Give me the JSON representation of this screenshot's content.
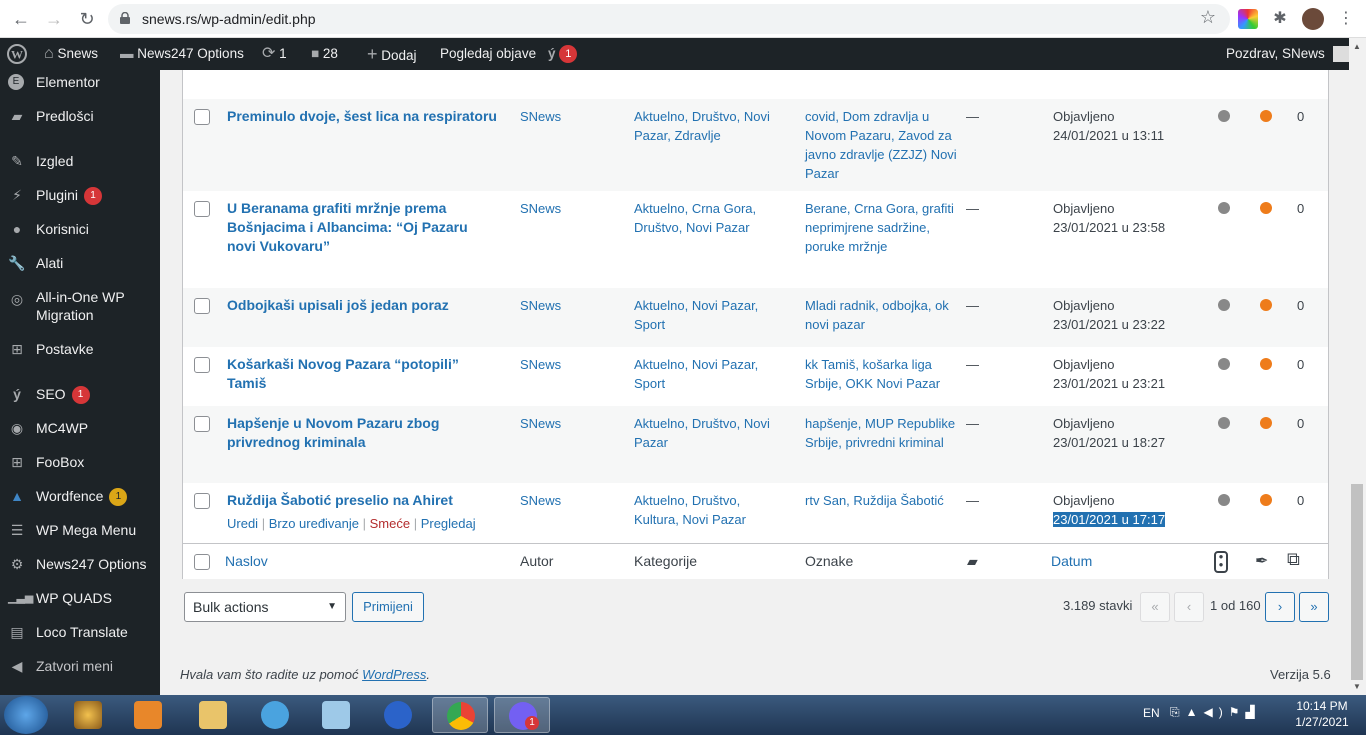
{
  "browser": {
    "url": "snews.rs/wp-admin/edit.php"
  },
  "adminbar": {
    "site": "Snews",
    "options": "News247 Options",
    "updates": "1",
    "comments": "28",
    "add": "Dodaj",
    "view": "Pogledaj objave",
    "seo_count": "1",
    "greeting": "Pozdrav, SNews"
  },
  "sidebar": {
    "items": [
      {
        "label": "Elementor",
        "icon": "elementor-icon"
      },
      {
        "label": "Predlošci",
        "icon": "folder-icon"
      },
      {
        "label": "Izgled",
        "icon": "brush-icon"
      },
      {
        "label": "Plugini",
        "icon": "plugin-icon",
        "badge": "1"
      },
      {
        "label": "Korisnici",
        "icon": "user-icon"
      },
      {
        "label": "Alati",
        "icon": "wrench-icon"
      },
      {
        "label": "All-in-One WP",
        "label2": "Migration",
        "icon": "migration-icon"
      },
      {
        "label": "Postavke",
        "icon": "settings-icon"
      },
      {
        "label": "SEO",
        "icon": "yoast-icon",
        "badge": "1"
      },
      {
        "label": "MC4WP",
        "icon": "mc4wp-icon"
      },
      {
        "label": "FooBox",
        "icon": "foobox-icon"
      },
      {
        "label": "Wordfence",
        "icon": "wordfence-icon",
        "badge": "1"
      },
      {
        "label": "WP Mega Menu",
        "icon": "menu-icon"
      },
      {
        "label": "News247 Options",
        "icon": "gear-icon"
      },
      {
        "label": "WP QUADS",
        "icon": "signal-icon"
      },
      {
        "label": "Loco Translate",
        "icon": "translate-icon"
      },
      {
        "label": "Zatvori meni",
        "icon": "collapse-icon"
      }
    ]
  },
  "posts": [
    {
      "title": "Preminulo dvoje, šest lica na respiratoru",
      "author": "SNews",
      "categories": "Aktuelno, Društvo, Novi Pazar, Zdravlje",
      "tags": "covid, Dom zdravlja u Novom Pazaru, Zavod za javno zdravlje (ZZJZ) Novi Pazar",
      "comments": "—",
      "status": "Objavljeno",
      "date": "24/01/2021 u 13:11",
      "count": "0"
    },
    {
      "title": "U Beranama grafiti mržnje prema Bošnjacima i Albancima: “Oj Pazaru novi Vukovaru”",
      "author": "SNews",
      "categories": "Aktuelno, Crna Gora, Društvo, Novi Pazar",
      "tags": "Berane, Crna Gora, grafiti neprimjrene sadržine, poruke mržnje",
      "comments": "—",
      "status": "Objavljeno",
      "date": "23/01/2021 u 23:58",
      "count": "0"
    },
    {
      "title": "Odbojkaši upisali još jedan poraz",
      "author": "SNews",
      "categories": "Aktuelno, Novi Pazar, Sport",
      "tags": "Mladi radnik, odbojka, ok novi pazar",
      "comments": "—",
      "status": "Objavljeno",
      "date": "23/01/2021 u 23:22",
      "count": "0"
    },
    {
      "title": "Košarkaši Novog Pazara “potopili” Tamiš",
      "author": "SNews",
      "categories": "Aktuelno, Novi Pazar, Sport",
      "tags": "kk Tamiš, košarka liga Srbije, OKK Novi Pazar",
      "comments": "—",
      "status": "Objavljeno",
      "date": "23/01/2021 u 23:21",
      "count": "0"
    },
    {
      "title": "Hapšenje u Novom Pazaru zbog privrednog kriminala",
      "author": "SNews",
      "categories": "Aktuelno, Društvo, Novi Pazar",
      "tags": "hapšenje, MUP Republike Srbije, privredni kriminal",
      "comments": "—",
      "status": "Objavljeno",
      "date": "23/01/2021 u 18:27",
      "count": "0"
    },
    {
      "title": "Ruždija Šabotić preselio na Ahiret",
      "author": "SNews",
      "categories": "Aktuelno, Društvo, Kultura, Novi Pazar",
      "tags": "rtv San, Ruždija Šabotić",
      "comments": "—",
      "status": "Objavljeno",
      "date": "23/01/2021 u 17:17",
      "count": "0"
    }
  ],
  "row_actions": {
    "edit": "Uredi",
    "quick": "Brzo uređivanje",
    "trash": "Smeće",
    "view": "Pregledaj"
  },
  "columns": {
    "title": "Naslov",
    "author": "Autor",
    "categories": "Kategorije",
    "tags": "Oznake",
    "date": "Datum"
  },
  "bulk": {
    "selected": "Bulk actions",
    "apply": "Primijeni"
  },
  "pagination": {
    "items": "3.189 stavki",
    "first": "«",
    "prev": "‹",
    "current": "1 od 160",
    "next": "›",
    "last": "»"
  },
  "footer": {
    "thanks_prefix": "Hvala vam što radite uz pomoć ",
    "wp_link": "WordPress",
    "thanks_suffix": ".",
    "version": "Verzija 5.6"
  },
  "taskbar": {
    "lang": "EN",
    "time": "10:14 PM",
    "date": "1/27/2021",
    "viber_badge": "1"
  },
  "colors": {
    "accent": "#2271b1",
    "admin": "#1d2327",
    "badge": "#d63638",
    "orange": "#ee7c1b"
  }
}
